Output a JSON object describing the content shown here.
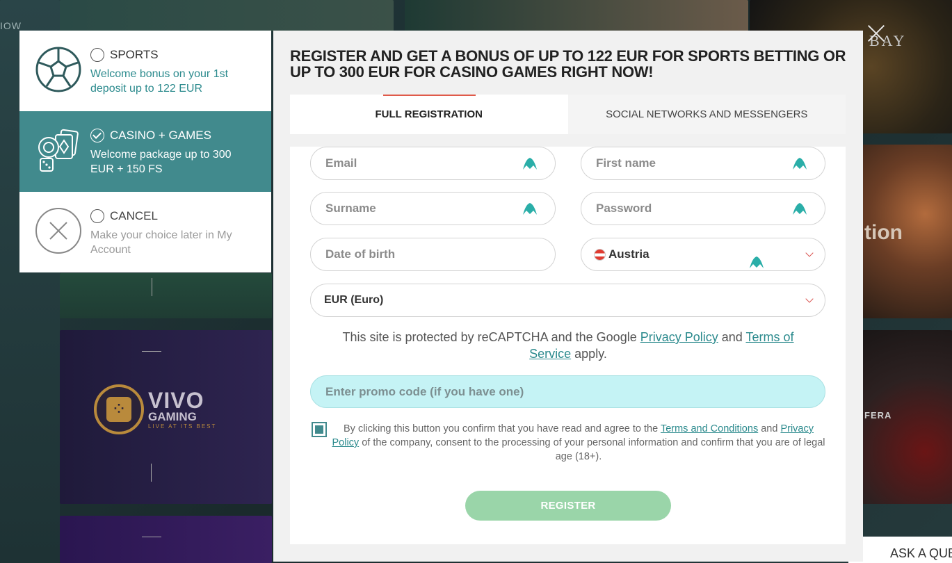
{
  "background": {
    "corner_text": "IOW",
    "tile_text_bay": "BAY",
    "tile_text_tion": "tion",
    "tile_text_fera": "FERA",
    "vivo": {
      "big": "VIVO",
      "mid": "GAMING",
      "small": "LIVE AT ITS BEST"
    },
    "ask_label": "ASK A QUE"
  },
  "bonus_options": [
    {
      "title": "SPORTS",
      "desc": "Welcome bonus on your 1st deposit up to 122 EUR",
      "selected": false,
      "icon": "soccer-ball-icon"
    },
    {
      "title": "CASINO + GAMES",
      "desc": "Welcome package up to 300 EUR + 150 FS",
      "selected": true,
      "icon": "casino-chips-cards-icon"
    },
    {
      "title": "CANCEL",
      "desc": "Make your choice later in My Account",
      "selected": false,
      "icon": "cancel-circle-icon"
    }
  ],
  "modal": {
    "title": "REGISTER AND GET A BONUS OF UP TO 122 EUR FOR SPORTS BETTING OR UP TO 300 EUR FOR CASINO GAMES RIGHT NOW!",
    "tabs": [
      {
        "label": "FULL REGISTRATION",
        "active": true
      },
      {
        "label": "SOCIAL NETWORKS AND MESSENGERS",
        "active": false
      }
    ],
    "fields": {
      "email": {
        "placeholder": "Email"
      },
      "first_name": {
        "placeholder": "First name"
      },
      "surname": {
        "placeholder": "Surname"
      },
      "password": {
        "placeholder": "Password"
      },
      "dob": {
        "placeholder": "Date of birth"
      },
      "country": {
        "value": "Austria"
      },
      "currency": {
        "value": "EUR (Euro)"
      }
    },
    "recaptcha": {
      "prefix": "This site is protected by reCAPTCHA and the Google ",
      "privacy_link": "Privacy Policy",
      "and": " and ",
      "terms_link": "Terms of Service",
      "suffix": " apply."
    },
    "promo_placeholder": "Enter promo code (if you have one)",
    "consent": {
      "prefix": "By clicking this button you confirm that you have read and agree to the ",
      "terms_link": "Terms and Conditions",
      "and": " and ",
      "privacy_link": "Privacy Policy",
      "suffix": " of the company, consent to the processing of your personal information and confirm that you are of legal age (18+).",
      "checked": true
    },
    "register_label": "REGISTER"
  },
  "colors": {
    "accent": "#418a8d",
    "link": "#2b8a8d",
    "tab_underline": "#e05a4a",
    "register_button": "#9ad5a9",
    "promo_bg": "#c5f3f5"
  }
}
